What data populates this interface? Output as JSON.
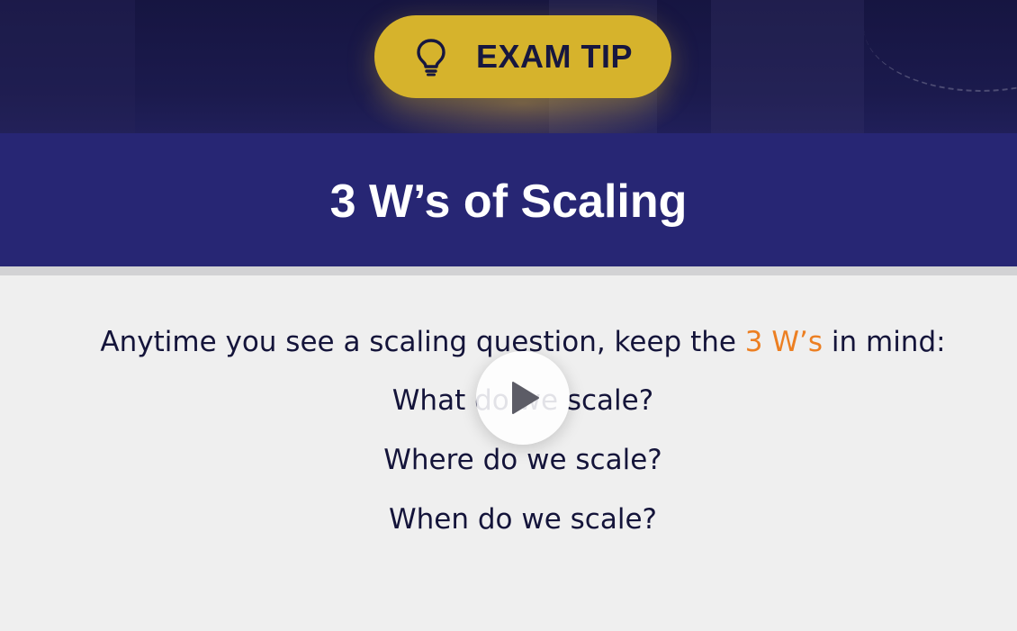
{
  "header": {
    "badge_label": "EXAM TIP",
    "badge_icon": "lightbulb-icon",
    "badge_color": "#d6b32c"
  },
  "title": "3 W’s of Scaling",
  "body": {
    "intro_before": "Anytime you see a scaling question, keep the ",
    "intro_highlight": "3 W’s",
    "intro_after": " in mind:",
    "questions": [
      "What do we scale?",
      "Where do we scale?",
      "When do we scale?"
    ]
  },
  "player": {
    "control_icon": "play-icon"
  },
  "colors": {
    "title_band": "#272674",
    "accent": "#ec7f22",
    "text": "#14143a",
    "background": "#efefef"
  }
}
